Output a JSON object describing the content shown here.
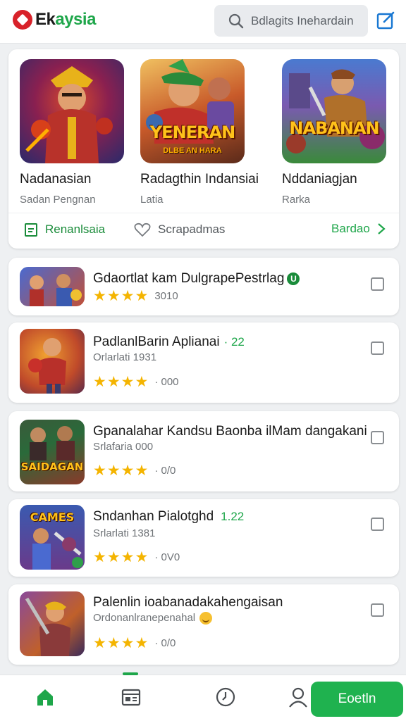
{
  "header": {
    "logo_part1": "Ek",
    "logo_part2": "aysia",
    "search_placeholder": "Bdlagits Inehardain"
  },
  "featured": {
    "items": [
      {
        "title": "Nadanasian",
        "subtitle": "Sadan Pengnan",
        "art_text": "",
        "art_subtext": ""
      },
      {
        "title": "Radagthin Indansiai",
        "subtitle": "Latia",
        "art_text": "YENERAN",
        "art_subtext": "DLBE AN HARA"
      },
      {
        "title": "Nddaniagjan",
        "subtitle": "Rarka",
        "art_text": "NABANAN",
        "art_subtext": ""
      }
    ],
    "footer": {
      "left_label": "Renanlsaia",
      "mid_label": "Scrapadmas",
      "right_label": "Bardao"
    }
  },
  "apps": [
    {
      "title": "Gdaortlat kam DulgrapePestrlag",
      "tag": "",
      "subtitle": "",
      "rating_text": "3010",
      "icon_text": ""
    },
    {
      "title": "PadlanlBarin Aplianai",
      "tag": "· 22",
      "subtitle": "Orlarlati 1931",
      "rating_text": "· 000",
      "icon_text": ""
    },
    {
      "title": "Gpanalahar Kandsu Baonba ilMam dangakani",
      "tag": "",
      "subtitle": "Srlafaria 000",
      "rating_text": "· 0/0",
      "icon_text": "SAIDAGAN"
    },
    {
      "title": "Sndanhan Pialotghd",
      "tag": "1.22",
      "subtitle": "Srlarlati 1381",
      "rating_text": "· 0V0",
      "icon_text": "CAMES"
    },
    {
      "title": "Palenlin ioabanadakahengaisan",
      "tag": "",
      "subtitle": "Ordonanlranepenahal",
      "rating_text": "· 0/0",
      "icon_text": ""
    }
  ],
  "bottom_nav": {
    "cta_label": "Eoetln"
  },
  "colors": {
    "brand_green": "#1ea64a",
    "brand_red": "#d8222a",
    "star": "#f4b400"
  },
  "icons": [
    "search-icon",
    "edit-icon",
    "calendar-icon",
    "heart-icon",
    "chevron-right-icon",
    "home-icon",
    "news-icon",
    "clock-icon",
    "person-icon"
  ]
}
